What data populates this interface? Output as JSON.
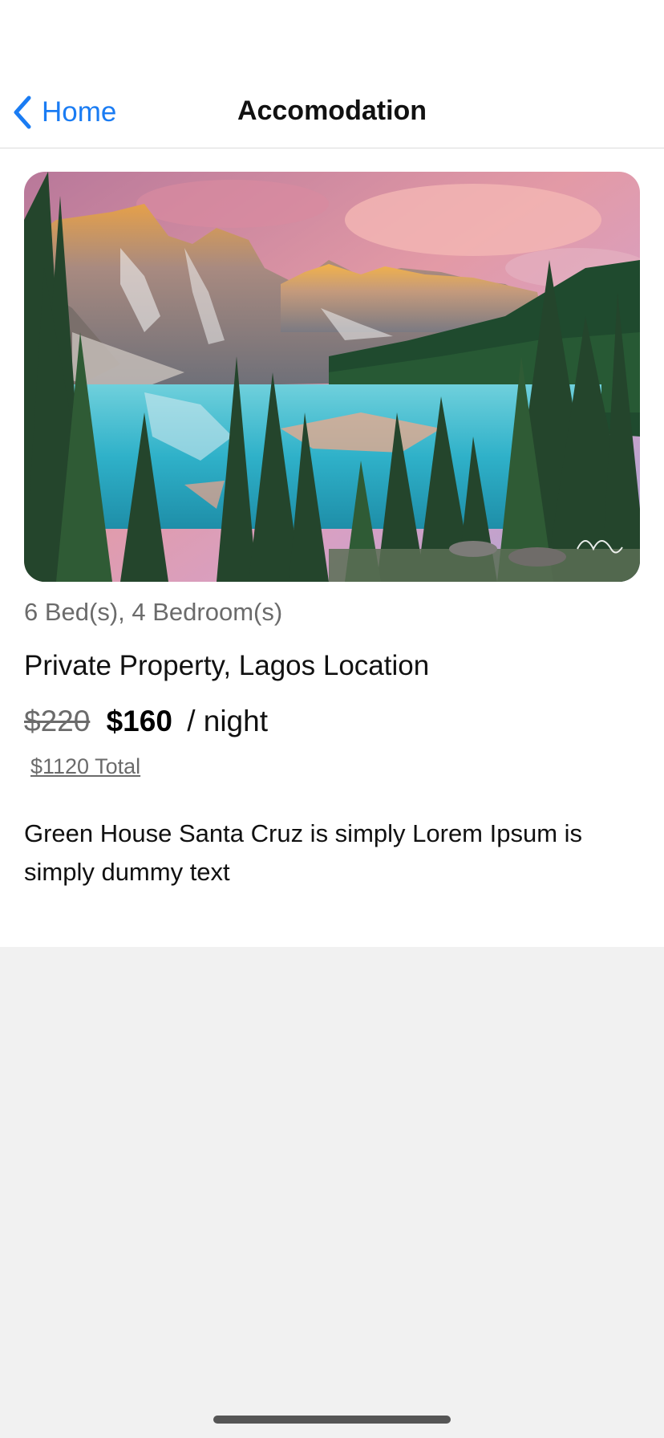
{
  "nav": {
    "back_label": "Home",
    "title": "Accomodation"
  },
  "listing": {
    "image": "mountain-lake-landscape",
    "beds": "6 Bed(s), 4 Bedroom(s)",
    "name": "Private Property, Lagos Location",
    "old_price": "$220",
    "new_price": "$160",
    "per_night": "/ night",
    "total": "$1120 Total",
    "description": "Green House Santa Cruz is simply Lorem Ipsum is simply dummy text"
  },
  "colors": {
    "accent": "#1a7cf3",
    "secondary_text": "#6b6b6b",
    "background": "#f1f1f1"
  }
}
